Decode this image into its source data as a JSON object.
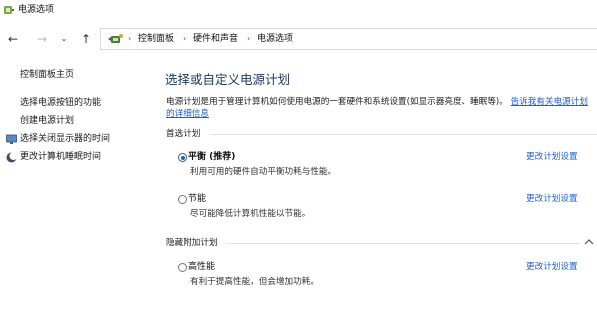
{
  "window": {
    "title": "电源选项"
  },
  "nav": {
    "back": "←",
    "forward": "→",
    "recent": "⌄",
    "up": "↑",
    "breadcrumbs": [
      "控制面板",
      "硬件和声音",
      "电源选项"
    ]
  },
  "sidebar": {
    "items": [
      {
        "label": "控制面板主页"
      },
      {
        "label": "选择电源按钮的功能"
      },
      {
        "label": "创建电源计划"
      },
      {
        "label": "选择关闭显示器的时间",
        "icon": "display-icon"
      },
      {
        "label": "更改计算机睡眠时间",
        "icon": "moon-icon"
      }
    ]
  },
  "main": {
    "title": "选择或自定义电源计划",
    "description": "电源计划是用于管理计算机如何使用电源的一套硬件和系统设置(如显示器亮度、睡眠等)。",
    "description_link": "告诉我有关电源计划的详细信息",
    "preferred_label": "首选计划",
    "hidden_label": "隐藏附加计划",
    "plans": [
      {
        "name": "平衡 (推荐)",
        "desc": "利用可用的硬件自动平衡功耗与性能。",
        "link": "更改计划设置",
        "selected": true
      },
      {
        "name": "节能",
        "desc": "尽可能降低计算机性能以节能。",
        "link": "更改计划设置",
        "selected": false
      },
      {
        "name": "高性能",
        "desc": "有利于提高性能，但会增加功耗。",
        "link": "更改计划设置",
        "selected": false
      }
    ]
  },
  "colors": {
    "link": "#1f5ec7",
    "title": "#1b3a63",
    "radio_selected": "#2a5f9e"
  }
}
